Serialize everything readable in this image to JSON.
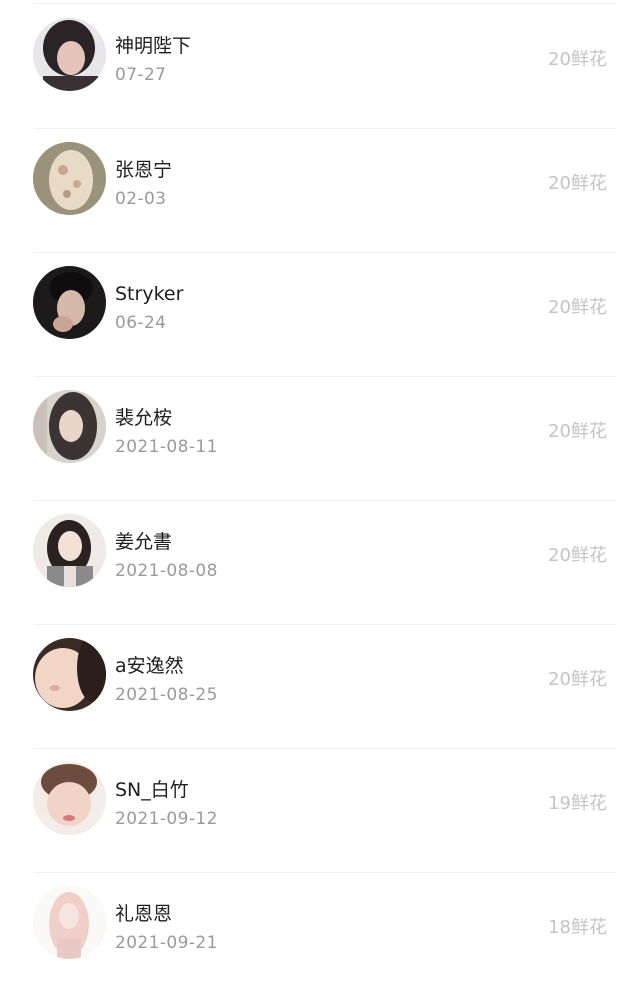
{
  "gift_list": {
    "unit_label": "鲜花",
    "rows": [
      {
        "name": "神明陛下",
        "date": "07-27",
        "flowers": "20鲜花",
        "avatar_icon": "avatar-photo-icon"
      },
      {
        "name": "张恩宁",
        "date": "02-03",
        "flowers": "20鲜花",
        "avatar_icon": "avatar-photo-icon"
      },
      {
        "name": "Stryker",
        "date": "06-24",
        "flowers": "20鲜花",
        "avatar_icon": "avatar-photo-icon"
      },
      {
        "name": "裴允桉",
        "date": "2021-08-11",
        "flowers": "20鲜花",
        "avatar_icon": "avatar-photo-icon"
      },
      {
        "name": "姜允書",
        "date": "2021-08-08",
        "flowers": "20鲜花",
        "avatar_icon": "avatar-photo-icon"
      },
      {
        "name": "a安逸然",
        "date": "2021-08-25",
        "flowers": "20鲜花",
        "avatar_icon": "avatar-photo-icon"
      },
      {
        "name": "SN_白竹",
        "date": "2021-09-12",
        "flowers": "19鲜花",
        "avatar_icon": "avatar-photo-icon"
      },
      {
        "name": "礼恩恩",
        "date": "2021-09-21",
        "flowers": "18鲜花",
        "avatar_icon": "avatar-photo-icon"
      }
    ]
  }
}
